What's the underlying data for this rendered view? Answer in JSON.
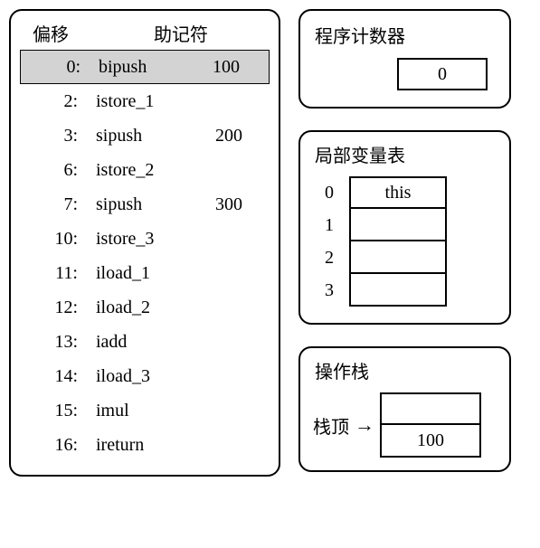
{
  "bytecode": {
    "header_offset": "偏移",
    "header_mnemonic": "助记符",
    "rows": [
      {
        "offset": "0:",
        "mnemonic": "bipush",
        "arg": "100",
        "highlight": true
      },
      {
        "offset": "2:",
        "mnemonic": "istore_1",
        "arg": ""
      },
      {
        "offset": "3:",
        "mnemonic": "sipush",
        "arg": "200"
      },
      {
        "offset": "6:",
        "mnemonic": "istore_2",
        "arg": ""
      },
      {
        "offset": "7:",
        "mnemonic": "sipush",
        "arg": "300"
      },
      {
        "offset": "10:",
        "mnemonic": "istore_3",
        "arg": ""
      },
      {
        "offset": "11:",
        "mnemonic": "iload_1",
        "arg": ""
      },
      {
        "offset": "12:",
        "mnemonic": "iload_2",
        "arg": ""
      },
      {
        "offset": "13:",
        "mnemonic": "iadd",
        "arg": ""
      },
      {
        "offset": "14:",
        "mnemonic": "iload_3",
        "arg": ""
      },
      {
        "offset": "15:",
        "mnemonic": "imul",
        "arg": ""
      },
      {
        "offset": "16:",
        "mnemonic": "ireturn",
        "arg": ""
      }
    ]
  },
  "pc": {
    "title": "程序计数器",
    "value": "0"
  },
  "local_vars": {
    "title": "局部变量表",
    "rows": [
      {
        "index": "0",
        "value": "this"
      },
      {
        "index": "1",
        "value": ""
      },
      {
        "index": "2",
        "value": ""
      },
      {
        "index": "3",
        "value": ""
      }
    ]
  },
  "operand_stack": {
    "title": "操作栈",
    "top_label": "栈顶",
    "arrow": "→",
    "cells": [
      {
        "value": ""
      },
      {
        "value": "100"
      }
    ]
  }
}
